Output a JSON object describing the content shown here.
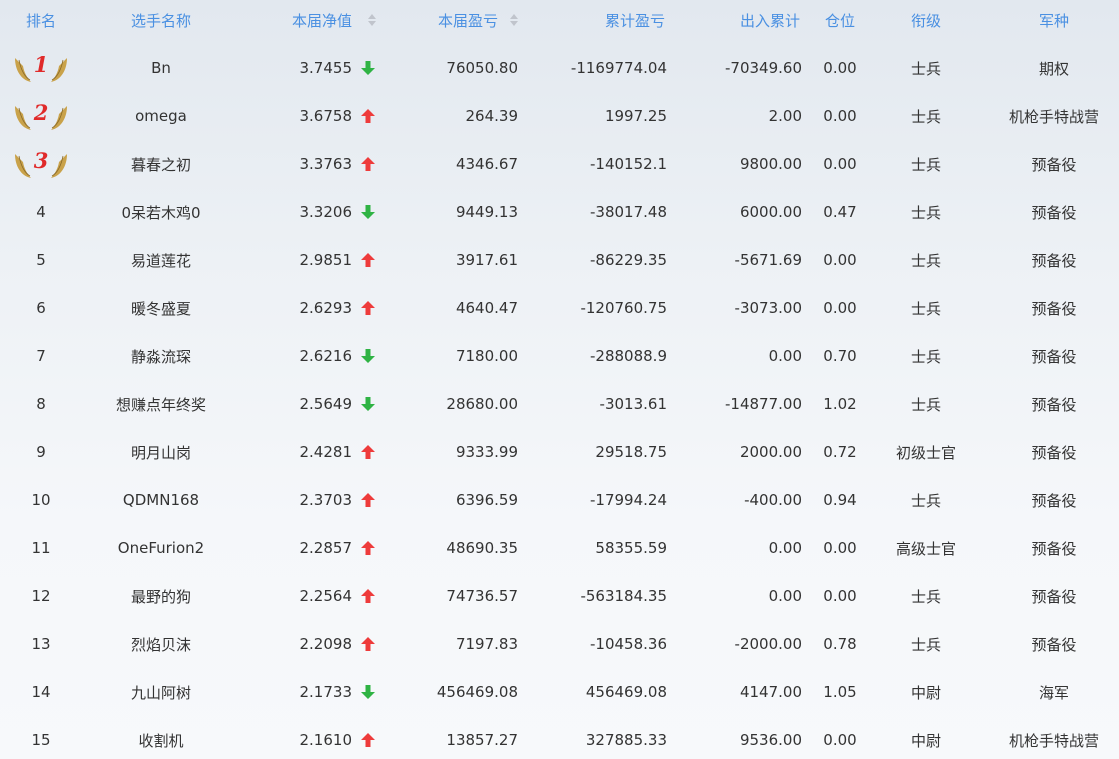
{
  "header": {
    "rank": "排名",
    "name": "选手名称",
    "nav": "本届净值",
    "pnl": "本届盈亏",
    "cumulative": "累计盈亏",
    "flow": "出入累计",
    "position": "仓位",
    "title": "衔级",
    "arm": "军种"
  },
  "colors": {
    "header_text": "#4a90e2",
    "arrow_up": "#ee3b3b",
    "arrow_down": "#2fb344",
    "medal_number": "#e02a2a",
    "wing": "#c9a24a"
  },
  "rows": [
    {
      "rank": "1",
      "name": "Bn",
      "nav": "3.7455",
      "trend": "down",
      "pnl": "76050.80",
      "cumulative": "-1169774.04",
      "flow": "-70349.60",
      "position": "0.00",
      "title": "士兵",
      "arm": "期权"
    },
    {
      "rank": "2",
      "name": "omega",
      "nav": "3.6758",
      "trend": "up",
      "pnl": "264.39",
      "cumulative": "1997.25",
      "flow": "2.00",
      "position": "0.00",
      "title": "士兵",
      "arm": "机枪手特战营"
    },
    {
      "rank": "3",
      "name": "暮春之初",
      "nav": "3.3763",
      "trend": "up",
      "pnl": "4346.67",
      "cumulative": "-140152.1",
      "flow": "9800.00",
      "position": "0.00",
      "title": "士兵",
      "arm": "预备役"
    },
    {
      "rank": "4",
      "name": "0呆若木鸡0",
      "nav": "3.3206",
      "trend": "down",
      "pnl": "9449.13",
      "cumulative": "-38017.48",
      "flow": "6000.00",
      "position": "0.47",
      "title": "士兵",
      "arm": "预备役"
    },
    {
      "rank": "5",
      "name": "易道莲花",
      "nav": "2.9851",
      "trend": "up",
      "pnl": "3917.61",
      "cumulative": "-86229.35",
      "flow": "-5671.69",
      "position": "0.00",
      "title": "士兵",
      "arm": "预备役"
    },
    {
      "rank": "6",
      "name": "暖冬盛夏",
      "nav": "2.6293",
      "trend": "up",
      "pnl": "4640.47",
      "cumulative": "-120760.75",
      "flow": "-3073.00",
      "position": "0.00",
      "title": "士兵",
      "arm": "预备役"
    },
    {
      "rank": "7",
      "name": "静淼流琛",
      "nav": "2.6216",
      "trend": "down",
      "pnl": "7180.00",
      "cumulative": "-288088.9",
      "flow": "0.00",
      "position": "0.70",
      "title": "士兵",
      "arm": "预备役"
    },
    {
      "rank": "8",
      "name": "想赚点年终奖",
      "nav": "2.5649",
      "trend": "down",
      "pnl": "28680.00",
      "cumulative": "-3013.61",
      "flow": "-14877.00",
      "position": "1.02",
      "title": "士兵",
      "arm": "预备役"
    },
    {
      "rank": "9",
      "name": "明月山岗",
      "nav": "2.4281",
      "trend": "up",
      "pnl": "9333.99",
      "cumulative": "29518.75",
      "flow": "2000.00",
      "position": "0.72",
      "title": "初级士官",
      "arm": "预备役"
    },
    {
      "rank": "10",
      "name": "QDMN168",
      "nav": "2.3703",
      "trend": "up",
      "pnl": "6396.59",
      "cumulative": "-17994.24",
      "flow": "-400.00",
      "position": "0.94",
      "title": "士兵",
      "arm": "预备役"
    },
    {
      "rank": "11",
      "name": "OneFurion2",
      "nav": "2.2857",
      "trend": "up",
      "pnl": "48690.35",
      "cumulative": "58355.59",
      "flow": "0.00",
      "position": "0.00",
      "title": "高级士官",
      "arm": "预备役"
    },
    {
      "rank": "12",
      "name": "最野的狗",
      "nav": "2.2564",
      "trend": "up",
      "pnl": "74736.57",
      "cumulative": "-563184.35",
      "flow": "0.00",
      "position": "0.00",
      "title": "士兵",
      "arm": "预备役"
    },
    {
      "rank": "13",
      "name": "烈焰贝沫",
      "nav": "2.2098",
      "trend": "up",
      "pnl": "7197.83",
      "cumulative": "-10458.36",
      "flow": "-2000.00",
      "position": "0.78",
      "title": "士兵",
      "arm": "预备役"
    },
    {
      "rank": "14",
      "name": "九山阿树",
      "nav": "2.1733",
      "trend": "down",
      "pnl": "456469.08",
      "cumulative": "456469.08",
      "flow": "4147.00",
      "position": "1.05",
      "title": "中尉",
      "arm": "海军"
    },
    {
      "rank": "15",
      "name": "收割机",
      "nav": "2.1610",
      "trend": "up",
      "pnl": "13857.27",
      "cumulative": "327885.33",
      "flow": "9536.00",
      "position": "0.00",
      "title": "中尉",
      "arm": "机枪手特战营"
    }
  ]
}
